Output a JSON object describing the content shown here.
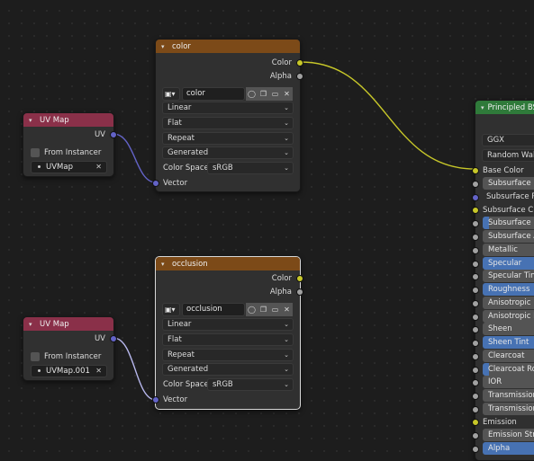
{
  "colors": {
    "texture_header": "#7c4a18",
    "uvmap_header": "#8a3049",
    "shader_header": "#2f7a3a",
    "socket_color": "#c7c729",
    "socket_float": "#a1a1a1",
    "socket_vector": "#6363c7",
    "wire_color": "#c7c729",
    "wire_vector": "#6363c7"
  },
  "color_node": {
    "title": "color",
    "outputs": [
      "Color",
      "Alpha"
    ],
    "image_name": "color",
    "interpolation": "Linear",
    "projection": "Flat",
    "extension": "Repeat",
    "source": "Generated",
    "color_space_label": "Color Space",
    "color_space": "sRGB",
    "input_vector": "Vector"
  },
  "occlusion_node": {
    "title": "occlusion",
    "outputs": [
      "Color",
      "Alpha"
    ],
    "image_name": "occlusion",
    "interpolation": "Linear",
    "projection": "Flat",
    "extension": "Repeat",
    "source": "Generated",
    "color_space_label": "Color Space",
    "color_space": "sRGB",
    "input_vector": "Vector"
  },
  "uvmap_node_1": {
    "title": "UV Map",
    "output": "UV",
    "from_instancer": "From Instancer",
    "uv_name": "UVMap"
  },
  "uvmap_node_2": {
    "title": "UV Map",
    "output": "UV",
    "from_instancer": "From Instancer",
    "uv_name": "UVMap.001"
  },
  "bsdf_node": {
    "title": "Principled BSDF",
    "distribution": "GGX",
    "subsurface_method": "Random Walk",
    "inputs": [
      "Base Color",
      "Subsurface",
      "Subsurface Radius",
      "Subsurface Color",
      "Subsurface IOR",
      "Subsurface Anisotropy",
      "Metallic",
      "Specular",
      "Specular Tint",
      "Roughness",
      "Anisotropic",
      "Anisotropic Rotation",
      "Sheen",
      "Sheen Tint",
      "Clearcoat",
      "Clearcoat Roughness",
      "IOR",
      "Transmission",
      "Transmission Roughness",
      "Emission",
      "Emission Strength",
      "Alpha"
    ],
    "visible": {
      "base_color": "Base Color",
      "subsurface": "Subsurface",
      "subsurface_radius": "Subsurface Rad",
      "subsurface_color": "Subsurface C...",
      "subsurface_ior": "Subsurface IO",
      "subsurface_aniso": "Subsurface An",
      "metallic": "Metallic",
      "specular": "Specular",
      "specular_tint": "Specular Tint",
      "roughness": "Roughness",
      "anisotropic": "Anisotropic",
      "anisotropic_rot": "Anisotropic Ro",
      "sheen": "Sheen",
      "sheen_tint": "Sheen Tint",
      "clearcoat": "Clearcoat",
      "clearcoat_rough": "Clearcoat Rou",
      "ior": "IOR",
      "transmission": "Transmission",
      "transmission_rough": "Transmission",
      "emission": "Emission",
      "emission_strength": "Emission Stre",
      "alpha": "Alpha"
    }
  }
}
